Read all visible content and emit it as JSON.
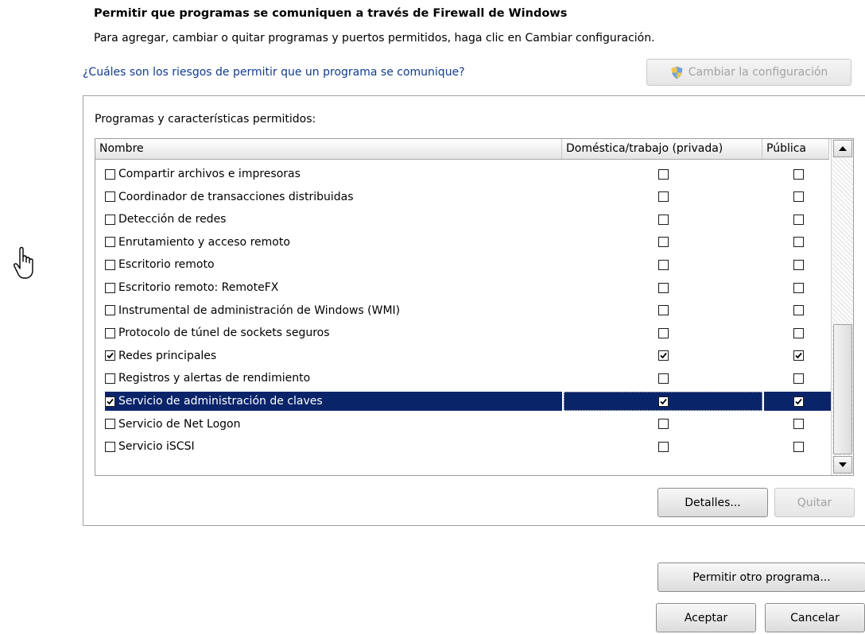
{
  "header": {
    "title": "Permitir que programas se comuniquen a través de Firewall de Windows",
    "subtitle": "Para agregar, cambiar o quitar programas y puertos permitidos, haga clic en Cambiar configuración.",
    "risk_link": "¿Cuáles son los riesgos de permitir que un programa se comunique?",
    "change_settings_button": "Cambiar la configuración",
    "change_settings_icon": "uac-shield-icon"
  },
  "allowed": {
    "group_label": "Programas y características permitidos:",
    "columns": {
      "name": "Nombre",
      "private": "Doméstica/trabajo (privada)",
      "public": "Pública"
    },
    "rows": [
      {
        "name": "Compartir archivos e impresoras",
        "enabled": false,
        "private": false,
        "public": false
      },
      {
        "name": "Coordinador de transacciones distribuidas",
        "enabled": false,
        "private": false,
        "public": false
      },
      {
        "name": "Detección de redes",
        "enabled": false,
        "private": false,
        "public": false
      },
      {
        "name": "Enrutamiento y acceso remoto",
        "enabled": false,
        "private": false,
        "public": false
      },
      {
        "name": "Escritorio remoto",
        "enabled": false,
        "private": false,
        "public": false
      },
      {
        "name": "Escritorio remoto: RemoteFX",
        "enabled": false,
        "private": false,
        "public": false
      },
      {
        "name": "Instrumental de administración de Windows (WMI)",
        "enabled": false,
        "private": false,
        "public": false
      },
      {
        "name": "Protocolo de túnel de sockets seguros",
        "enabled": false,
        "private": false,
        "public": false
      },
      {
        "name": "Redes principales",
        "enabled": true,
        "private": true,
        "public": true
      },
      {
        "name": "Registros y alertas de rendimiento",
        "enabled": false,
        "private": false,
        "public": false
      },
      {
        "name": "Servicio de administración de claves",
        "enabled": true,
        "private": true,
        "public": true,
        "selected": true
      },
      {
        "name": "Servicio de Net Logon",
        "enabled": false,
        "private": false,
        "public": false
      },
      {
        "name": "Servicio iSCSI",
        "enabled": false,
        "private": false,
        "public": false
      }
    ],
    "details_button": "Detalles...",
    "remove_button": "Quitar",
    "remove_disabled": true
  },
  "allow_other_button": "Permitir otro programa...",
  "footer": {
    "ok_button": "Aceptar",
    "cancel_button": "Cancelar"
  },
  "colors": {
    "selection": "#0a246a",
    "link": "#0f3c8c"
  }
}
